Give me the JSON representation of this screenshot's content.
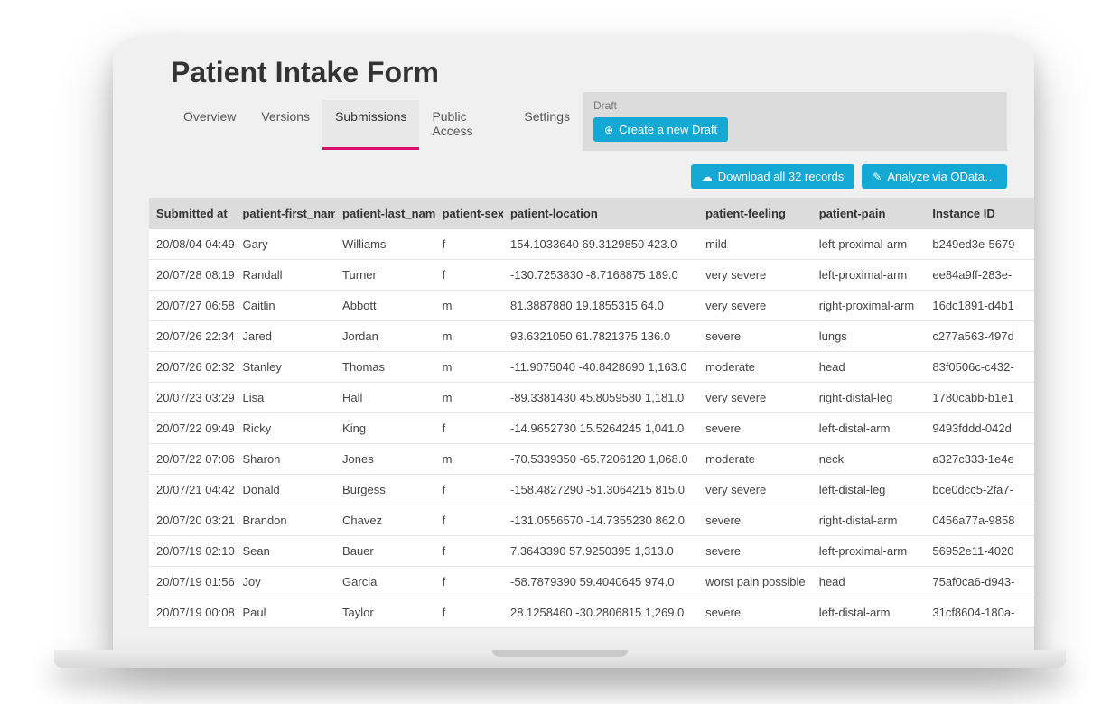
{
  "page_title": "Patient Intake Form",
  "tabs": [
    "Overview",
    "Versions",
    "Submissions",
    "Public Access",
    "Settings"
  ],
  "active_tab": "Submissions",
  "draft": {
    "label": "Draft",
    "button": "Create a new Draft"
  },
  "actions": {
    "download": "Download all 32 records",
    "analyze": "Analyze via OData…"
  },
  "columns": [
    "Submitted at",
    "patient-first_name",
    "patient-last_name",
    "patient-sex",
    "patient-location",
    "patient-feeling",
    "patient-pain",
    "Instance ID"
  ],
  "rows": [
    {
      "submitted": "20/08/04 04:49",
      "first": "Gary",
      "last": "Williams",
      "sex": "f",
      "location": "154.1033640 69.3129850 423.0",
      "feeling": "mild",
      "pain": "left-proximal-arm",
      "id": "b249ed3e-5679"
    },
    {
      "submitted": "20/07/28 08:19",
      "first": "Randall",
      "last": "Turner",
      "sex": "f",
      "location": "-130.7253830 -8.7168875 189.0",
      "feeling": "very severe",
      "pain": "left-proximal-arm",
      "id": "ee84a9ff-283e-"
    },
    {
      "submitted": "20/07/27 06:58",
      "first": "Caitlin",
      "last": "Abbott",
      "sex": "m",
      "location": "81.3887880 19.1855315 64.0",
      "feeling": "very severe",
      "pain": "right-proximal-arm",
      "id": "16dc1891-d4b1"
    },
    {
      "submitted": "20/07/26 22:34",
      "first": "Jared",
      "last": "Jordan",
      "sex": "m",
      "location": "93.6321050 61.7821375 136.0",
      "feeling": "severe",
      "pain": "lungs",
      "id": "c277a563-497d"
    },
    {
      "submitted": "20/07/26 02:32",
      "first": "Stanley",
      "last": "Thomas",
      "sex": "m",
      "location": "-11.9075040 -40.8428690 1,163.0",
      "feeling": "moderate",
      "pain": "head",
      "id": "83f0506c-c432-"
    },
    {
      "submitted": "20/07/23 03:29",
      "first": "Lisa",
      "last": "Hall",
      "sex": "m",
      "location": "-89.3381430 45.8059580 1,181.0",
      "feeling": "very severe",
      "pain": "right-distal-leg",
      "id": "1780cabb-b1e1"
    },
    {
      "submitted": "20/07/22 09:49",
      "first": "Ricky",
      "last": "King",
      "sex": "f",
      "location": "-14.9652730 15.5264245 1,041.0",
      "feeling": "severe",
      "pain": "left-distal-arm",
      "id": "9493fddd-042d"
    },
    {
      "submitted": "20/07/22 07:06",
      "first": "Sharon",
      "last": "Jones",
      "sex": "m",
      "location": "-70.5339350 -65.7206120 1,068.0",
      "feeling": "moderate",
      "pain": "neck",
      "id": "a327c333-1e4e"
    },
    {
      "submitted": "20/07/21 04:42",
      "first": "Donald",
      "last": "Burgess",
      "sex": "f",
      "location": "-158.4827290 -51.3064215 815.0",
      "feeling": "very severe",
      "pain": "left-distal-leg",
      "id": "bce0dcc5-2fa7-"
    },
    {
      "submitted": "20/07/20 03:21",
      "first": "Brandon",
      "last": "Chavez",
      "sex": "f",
      "location": "-131.0556570 -14.7355230 862.0",
      "feeling": "severe",
      "pain": "right-distal-arm",
      "id": "0456a77a-9858"
    },
    {
      "submitted": "20/07/19 02:10",
      "first": "Sean",
      "last": "Bauer",
      "sex": "f",
      "location": "7.3643390 57.9250395 1,313.0",
      "feeling": "severe",
      "pain": "left-proximal-arm",
      "id": "56952e11-4020"
    },
    {
      "submitted": "20/07/19 01:56",
      "first": "Joy",
      "last": "Garcia",
      "sex": "f",
      "location": "-58.7879390 59.4040645 974.0",
      "feeling": "worst pain possible",
      "pain": "head",
      "id": "75af0ca6-d943-"
    },
    {
      "submitted": "20/07/19 00:08",
      "first": "Paul",
      "last": "Taylor",
      "sex": "f",
      "location": "28.1258460 -30.2806815 1,269.0",
      "feeling": "severe",
      "pain": "left-distal-arm",
      "id": "31cf8604-180a-"
    }
  ]
}
